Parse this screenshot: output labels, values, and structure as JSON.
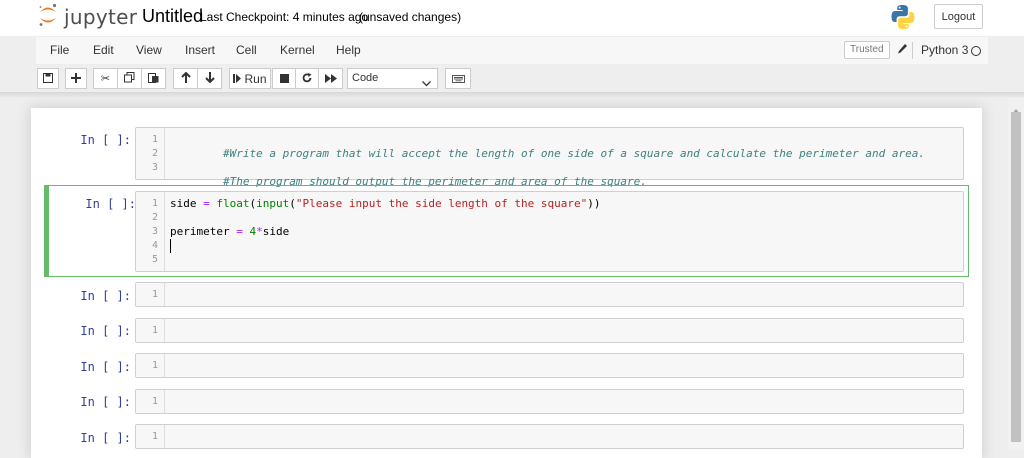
{
  "header": {
    "logo_text": "jupyter",
    "notebook_name": "Untitled",
    "checkpoint": "Last Checkpoint: 4 minutes ago",
    "autosave": "(unsaved changes)",
    "logout_label": "Logout"
  },
  "menubar": {
    "items": [
      "File",
      "Edit",
      "View",
      "Insert",
      "Cell",
      "Kernel",
      "Help"
    ],
    "trusted_label": "Trusted",
    "kernel_name": "Python 3"
  },
  "toolbar": {
    "run_label": "Run",
    "cell_type": "Code",
    "icons": [
      "save-icon",
      "plus-icon",
      "cut-icon",
      "copy-icon",
      "paste-icon",
      "arrow-up-icon",
      "arrow-down-icon",
      "run-icon",
      "stop-icon",
      "restart-icon",
      "fast-forward-icon",
      "keyboard-icon"
    ]
  },
  "cells": [
    {
      "prompt": "In [ ]:",
      "line_numbers": [
        "1",
        "2",
        "3"
      ],
      "lines": [
        [
          {
            "t": "#Write a program that will accept the length of one side of a square and calculate the perimeter and area.",
            "c": "cmt"
          }
        ],
        [],
        [
          {
            "t": "#The program should output the perimeter and area of the square.",
            "c": "cmt"
          }
        ]
      ]
    },
    {
      "prompt": "In [ ]:",
      "line_numbers": [
        "1",
        "2",
        "3",
        "4",
        "5"
      ],
      "lines": [
        [
          {
            "t": "side ",
            "c": ""
          },
          {
            "t": "=",
            "c": "op"
          },
          {
            "t": " ",
            "c": ""
          },
          {
            "t": "float",
            "c": "bi"
          },
          {
            "t": "(",
            "c": ""
          },
          {
            "t": "input",
            "c": "bi"
          },
          {
            "t": "(",
            "c": ""
          },
          {
            "t": "\"Please input the side length of the square\"",
            "c": "str"
          },
          {
            "t": "))",
            "c": ""
          }
        ],
        [],
        [
          {
            "t": "perimeter ",
            "c": ""
          },
          {
            "t": "=",
            "c": "op"
          },
          {
            "t": " ",
            "c": ""
          },
          {
            "t": "4",
            "c": "num"
          },
          {
            "t": "*",
            "c": "op"
          },
          {
            "t": "side",
            "c": ""
          }
        ],
        [],
        []
      ]
    },
    {
      "prompt": "In [ ]:",
      "line_numbers": [
        "1"
      ],
      "lines": [
        []
      ]
    },
    {
      "prompt": "In [ ]:",
      "line_numbers": [
        "1"
      ],
      "lines": [
        []
      ]
    },
    {
      "prompt": "In [ ]:",
      "line_numbers": [
        "1"
      ],
      "lines": [
        []
      ]
    },
    {
      "prompt": "In [ ]:",
      "line_numbers": [
        "1"
      ],
      "lines": [
        []
      ]
    },
    {
      "prompt": "In [ ]:",
      "line_numbers": [
        "1"
      ],
      "lines": [
        []
      ]
    }
  ],
  "colors": {
    "prompt": "#303f9f",
    "edit_border": "#66bb6a",
    "comment": "#408080",
    "string": "#ba2121",
    "builtin": "#008000",
    "operator": "#aa22ff"
  }
}
